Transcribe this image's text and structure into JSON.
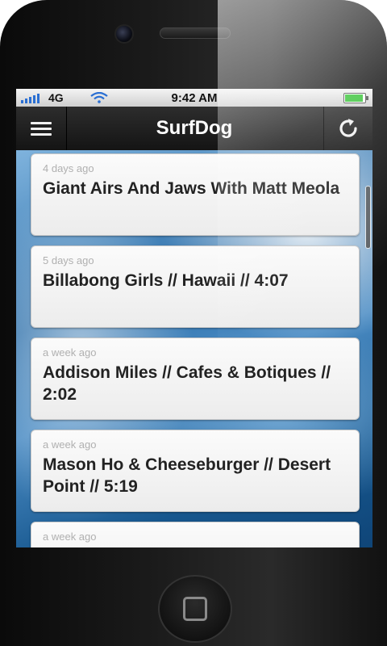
{
  "status_bar": {
    "carrier": "4G",
    "time": "9:42 AM",
    "battery_level_percent": 90
  },
  "header": {
    "title": "SurfDog",
    "menu_icon": "hamburger-menu-icon",
    "refresh_icon": "refresh-icon"
  },
  "videos": [
    {
      "time": "4 days ago",
      "title": "Giant Airs And Jaws With Matt Meola"
    },
    {
      "time": "5 days ago",
      "title": "Billabong Girls // Hawaii // 4:07"
    },
    {
      "time": "a week ago",
      "title": "Addison Miles // Cafes & Botiques // 2:02"
    },
    {
      "time": "a week ago",
      "title": "Mason Ho & Cheeseburger // Desert Point // 5:19"
    },
    {
      "time": "a week ago",
      "title": ""
    }
  ],
  "colors": {
    "navbar": "#1f1f1f",
    "card": "#f5f5f5",
    "accent_blue": "#2a6fd3"
  }
}
